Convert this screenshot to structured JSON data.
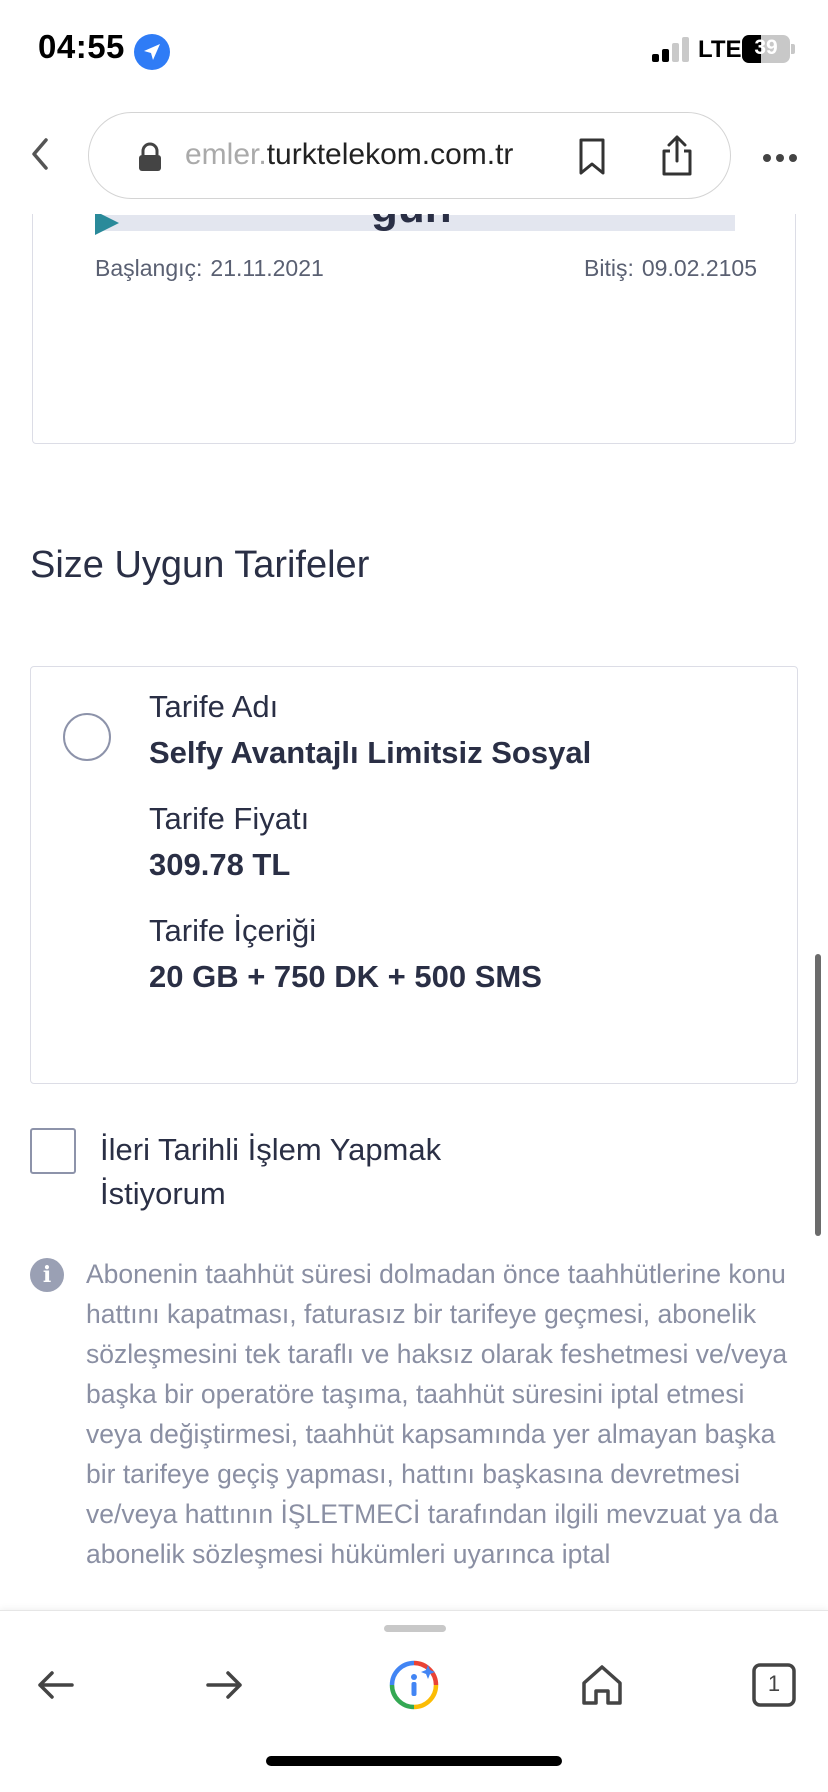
{
  "status_bar": {
    "time": "04:55",
    "network": "LTE",
    "battery": "39"
  },
  "browser": {
    "url_faded": "emler.",
    "url_main": "turktelekom.com.tr"
  },
  "period": {
    "remaining_unit": "gün",
    "start_label": "Başlangıç:",
    "start_date": "21.11.2021",
    "end_label": "Bitiş:",
    "end_date": "09.02.2105",
    "progress_fraction": 0.0
  },
  "section_title": "Size Uygun Tarifeler",
  "tariff": {
    "name_label": "Tarife Adı",
    "name_value": "Selfy Avantajlı Limitsiz Sosyal",
    "price_label": "Tarife Fiyatı",
    "price_value": "309.78 TL",
    "content_label": "Tarife İçeriği",
    "content_value": "20 GB + 750 DK + 500 SMS"
  },
  "future_transaction": {
    "label": "İleri Tarihli İşlem Yapmak İstiyorum",
    "checked": false
  },
  "info_text": "Abonenin taahhüt süresi dolmadan önce taahhütlerine konu hattını kapatması, faturasız bir tarifeye geçmesi, abonelik sözleşmesini tek taraflı ve haksız olarak feshetmesi ve/veya başka bir operatöre taşıma, taahhüt süresini iptal etmesi veya değiştirmesi, taahhüt kapsamında yer almayan başka bir tarifeye geçiş yapması, hattını başkasına devretmesi ve/veya hattının İŞLETMECİ tarafından ilgili mevzuat ya da abonelik sözleşmesi hükümleri uyarınca iptal",
  "toolbar": {
    "tab_count": "1"
  },
  "colors": {
    "accent": "#2a8a9a",
    "text": "#2a2f45",
    "muted": "#8a8fa3",
    "location": "#2f7cf6"
  },
  "icons": [
    "location-arrow-icon",
    "signal-icon",
    "battery-icon",
    "chevron-left-icon",
    "lock-icon",
    "bookmark-icon",
    "share-icon",
    "more-icon",
    "info-icon",
    "back-arrow-icon",
    "forward-arrow-icon",
    "google-lens-icon",
    "home-icon",
    "tabs-icon"
  ]
}
